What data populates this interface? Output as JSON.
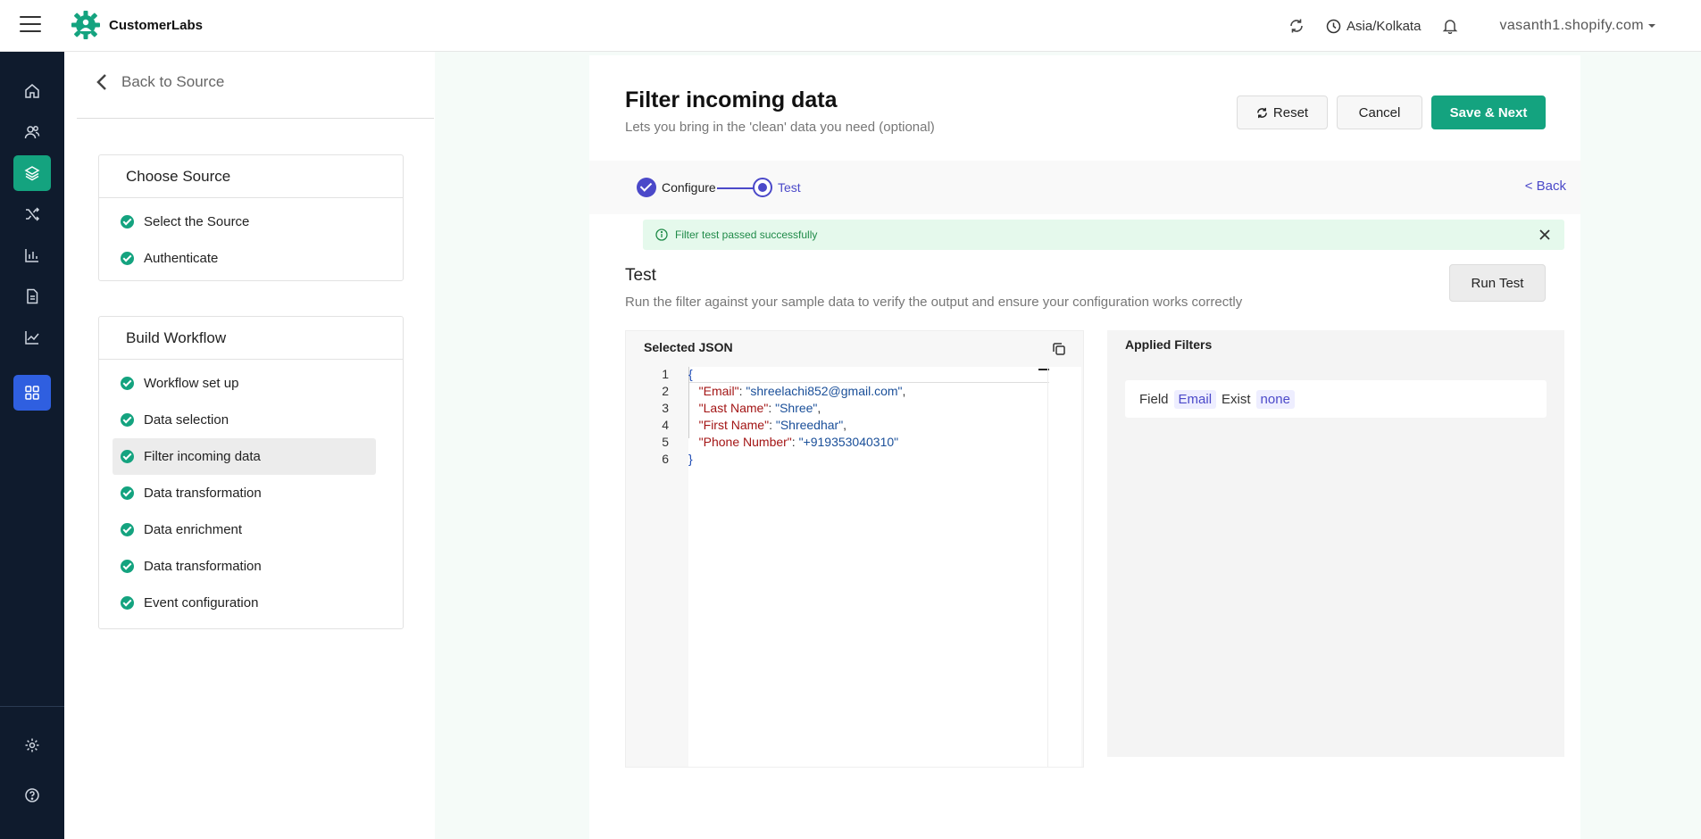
{
  "app": {
    "name": "CustomerLabs"
  },
  "topbar": {
    "timezone": "Asia/Kolkata",
    "account": "vasanth1.shopify.com"
  },
  "rail": {
    "items": [
      "home-icon",
      "users-icon",
      "layers-icon",
      "shuffle-icon",
      "chart-icon",
      "document-icon",
      "trend-icon",
      "apps-icon"
    ],
    "bottom": [
      "settings-icon",
      "help-icon"
    ]
  },
  "sidebar": {
    "back_label": "Back to Source",
    "choose_source": {
      "title": "Choose Source",
      "steps": [
        "Select the Source",
        "Authenticate"
      ]
    },
    "build_workflow": {
      "title": "Build Workflow",
      "steps": [
        "Workflow set up",
        "Data selection",
        "Filter incoming data",
        "Data transformation",
        "Data enrichment",
        "Data transformation",
        "Event configuration"
      ]
    }
  },
  "main": {
    "title": "Filter incoming data",
    "subtitle": "Lets you bring in the 'clean' data you need (optional)",
    "buttons": {
      "reset": "Reset",
      "cancel": "Cancel",
      "save": "Save & Next"
    },
    "stepper": {
      "configure": "Configure",
      "test": "Test",
      "back": "< Back"
    },
    "alert": "Filter test passed successfully",
    "test": {
      "title": "Test",
      "description": "Run the filter against your sample data to verify the output and ensure your configuration works correctly",
      "run_button": "Run Test"
    },
    "json_panel": {
      "title": "Selected JSON",
      "line_numbers": [
        "1",
        "2",
        "3",
        "4",
        "5",
        "6"
      ],
      "open_brace": "{",
      "close_brace": "}",
      "entries": [
        {
          "key": "\"Email\"",
          "value": "\"shreelachi852@gmail.com\"",
          "trail": ","
        },
        {
          "key": "\"Last Name\"",
          "value": "\"Shree\"",
          "trail": ","
        },
        {
          "key": "\"First Name\"",
          "value": "\"Shreedhar\"",
          "trail": ","
        },
        {
          "key": "\"Phone Number\"",
          "value": "\"+919353040310\"",
          "trail": ""
        }
      ]
    },
    "filters_panel": {
      "title": "Applied Filters",
      "row": {
        "field_label": "Field",
        "field": "Email",
        "operator": "Exist",
        "value": "none"
      }
    }
  },
  "colors": {
    "accent_green": "#14a37f",
    "accent_purple": "#4b49c9",
    "rail_bg": "#0f1b2d"
  }
}
